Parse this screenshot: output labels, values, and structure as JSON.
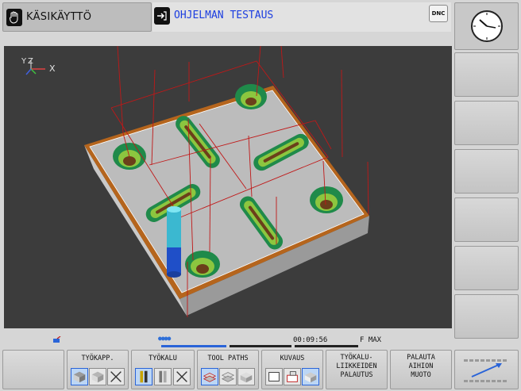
{
  "header": {
    "mode_title": "KÄSIKÄYTTÖ",
    "program_title": "OHJELMAN TESTAUS",
    "dnc_label": "DNC"
  },
  "viewport": {
    "axis_labels": {
      "y": "Y",
      "z": "Z",
      "x": "X"
    },
    "background_color": "#3c3c3c"
  },
  "status": {
    "run_time": "00:09:56",
    "feed": "F MAX"
  },
  "softkeys_bottom": [
    {
      "label": "",
      "icons": []
    },
    {
      "label": "TYÖKAPP.",
      "icons": [
        "box-solid",
        "box-grey",
        "box-cross"
      ]
    },
    {
      "label": "TYÖKALU",
      "icons": [
        "tool-solid",
        "tool-grey",
        "tool-cross"
      ]
    },
    {
      "label": "TOOL PATHS",
      "icons": [
        "path-all",
        "path-layer",
        "path-end"
      ]
    },
    {
      "label": "KUVAUS",
      "icons": [
        "view-blank",
        "view-mixed",
        "view-solid"
      ]
    },
    {
      "label": "TYÖKALU-\nLIIKKEIDEN\nPALAUTUS",
      "icons": []
    },
    {
      "label": "PALAUTA\nAIHION\nMUOTO",
      "icons": []
    },
    {
      "label": "",
      "icons": [
        "arrow-up-right"
      ]
    }
  ],
  "softkeys_right_count": 6
}
